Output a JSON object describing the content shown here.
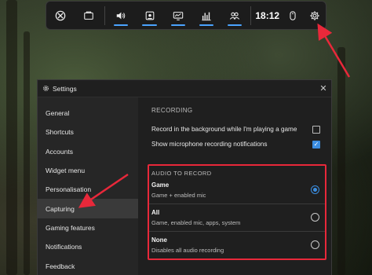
{
  "gamebar": {
    "buttons": [
      {
        "icon": "xbox-icon",
        "active": false
      },
      {
        "icon": "widget-store-icon",
        "active": false
      },
      {
        "icon": "audio-icon",
        "active": true
      },
      {
        "icon": "capture-icon",
        "active": true
      },
      {
        "icon": "performance-monitor-icon",
        "active": true
      },
      {
        "icon": "resources-icon",
        "active": true
      },
      {
        "icon": "xbox-social-icon",
        "active": true
      }
    ],
    "time": "18:12"
  },
  "settings": {
    "title": "Settings",
    "close_glyph": "✕",
    "nav": [
      "General",
      "Shortcuts",
      "Accounts",
      "Widget menu",
      "Personalisation",
      "Capturing",
      "Gaming features",
      "Notifications",
      "Feedback"
    ],
    "selected_nav": "Capturing",
    "recording": {
      "title": "RECORDING",
      "options": [
        {
          "label": "Record in the background while I'm playing a game",
          "checked": false
        },
        {
          "label": "Show microphone recording notifications",
          "checked": true
        }
      ]
    },
    "audio": {
      "title": "AUDIO TO RECORD",
      "options": [
        {
          "name": "Game",
          "desc": "Game + enabled mic",
          "selected": true
        },
        {
          "name": "All",
          "desc": "Game, enabled mic, apps, system",
          "selected": false
        },
        {
          "name": "None",
          "desc": "Disables all audio recording",
          "selected": false
        }
      ]
    }
  },
  "colors": {
    "accent": "#3b8de0",
    "highlight_red": "#e8283a"
  }
}
